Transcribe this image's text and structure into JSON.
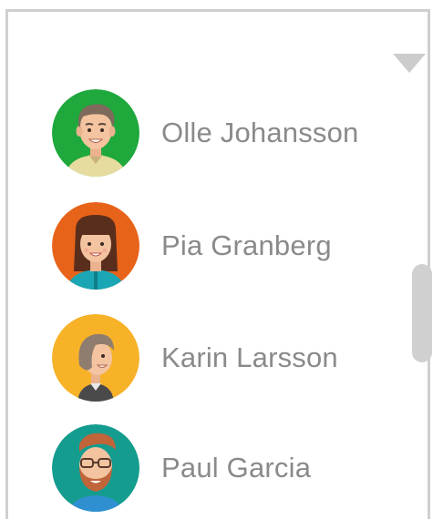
{
  "contacts": [
    {
      "name": "Olle Johansson",
      "avatar_bg": "#1fa83c",
      "avatar_icon": "man-short-hair-avatar"
    },
    {
      "name": "Pia Granberg",
      "avatar_bg": "#e8631a",
      "avatar_icon": "woman-bangs-avatar"
    },
    {
      "name": "Karin Larsson",
      "avatar_bg": "#f7b228",
      "avatar_icon": "woman-side-hair-avatar"
    },
    {
      "name": "Paul Garcia",
      "avatar_bg": "#149c8f",
      "avatar_icon": "man-beard-avatar"
    }
  ],
  "colors": {
    "border": "#cfcfcf",
    "name_text": "#8a8a8a",
    "scrollbar_thumb": "#d0d0d0",
    "dropdown_arrow": "#cccccc"
  },
  "icons": {
    "dropdown": "triangle-down-icon",
    "scrollbar": "scrollbar-thumb"
  }
}
